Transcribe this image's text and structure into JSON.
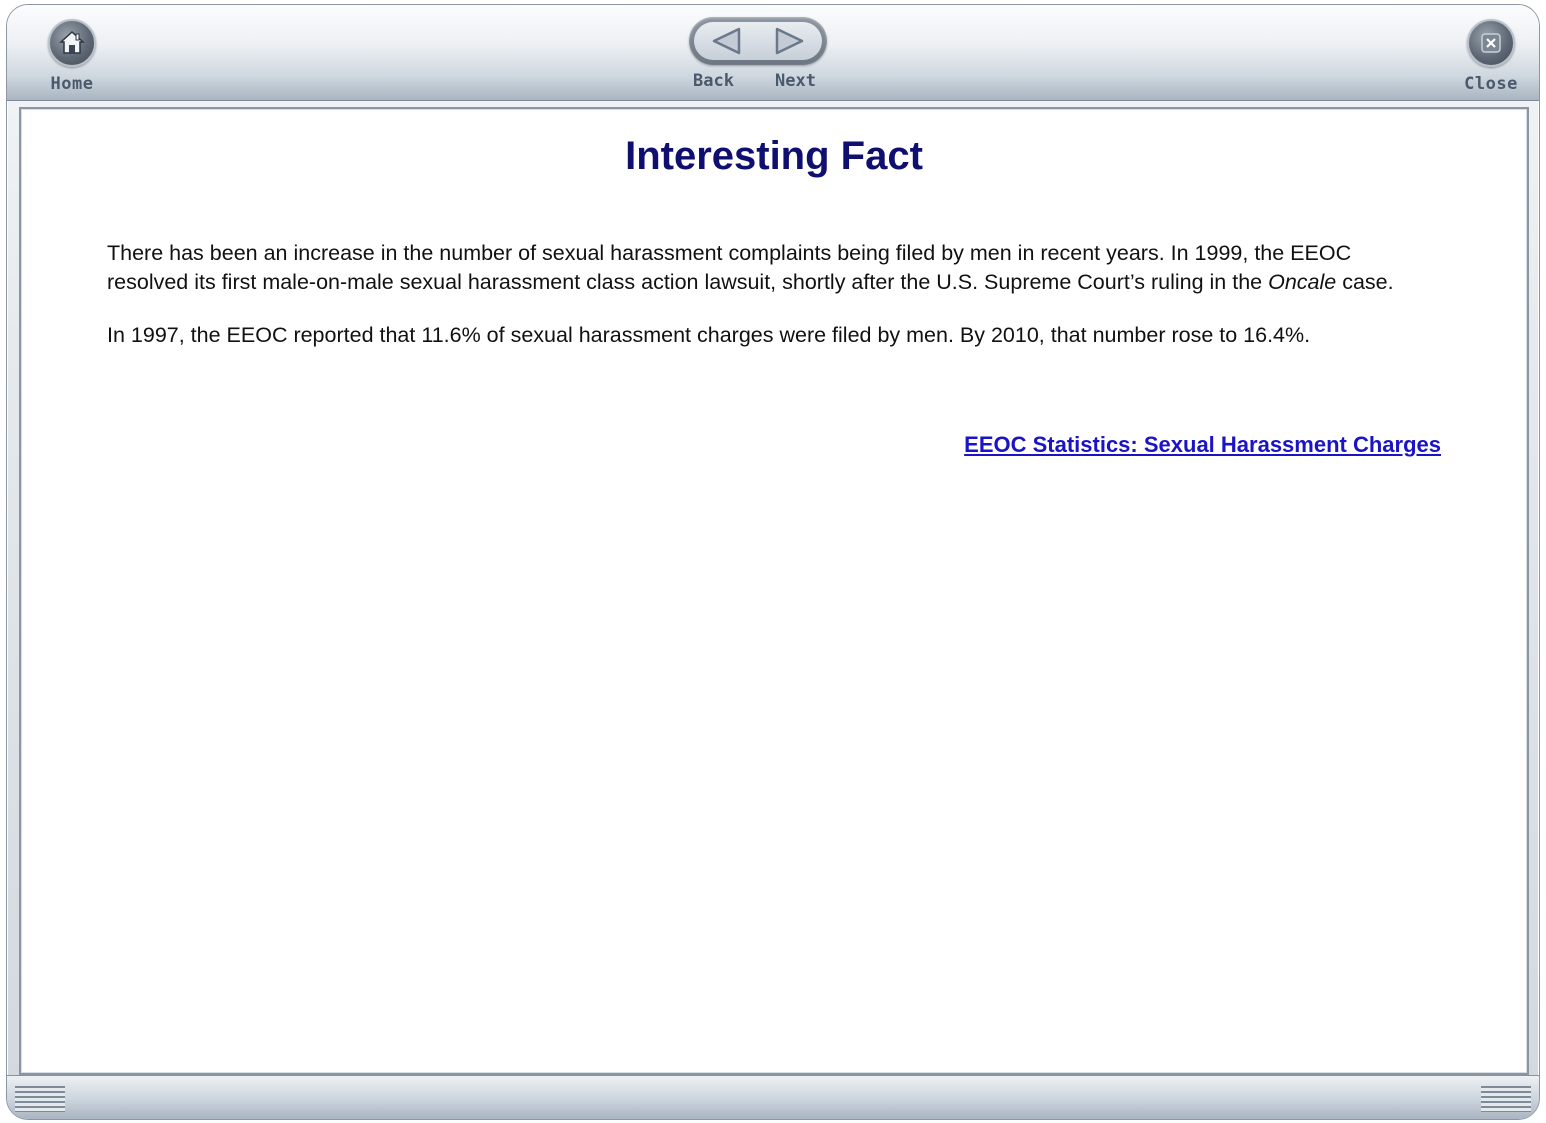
{
  "toolbar": {
    "home_label": "Home",
    "back_label": "Back",
    "next_label": "Next",
    "close_label": "Close"
  },
  "content": {
    "title": "Interesting Fact",
    "paragraph1_before": "There has been an increase in the number of sexual harassment complaints being filed by men in recent years. In 1999, the EEOC resolved its first male-on-male sexual harassment class action lawsuit, shortly after the U.S. Supreme Court’s ruling in the ",
    "paragraph1_italic": "Oncale",
    "paragraph1_after": " case.",
    "paragraph2": "In 1997, the EEOC reported that 11.6% of sexual harassment charges were filed by men. By 2010, that number rose to 16.4%.",
    "link_text": "EEOC Statistics: Sexual Harassment Charges"
  },
  "colors": {
    "title": "#0e0f6e",
    "link": "#1a14c6",
    "body_text": "#111111",
    "toolbar_label": "#4a5a6c"
  },
  "icons": {
    "home": "home-icon",
    "back": "back-arrow-icon",
    "next": "next-arrow-icon",
    "close": "close-icon"
  }
}
